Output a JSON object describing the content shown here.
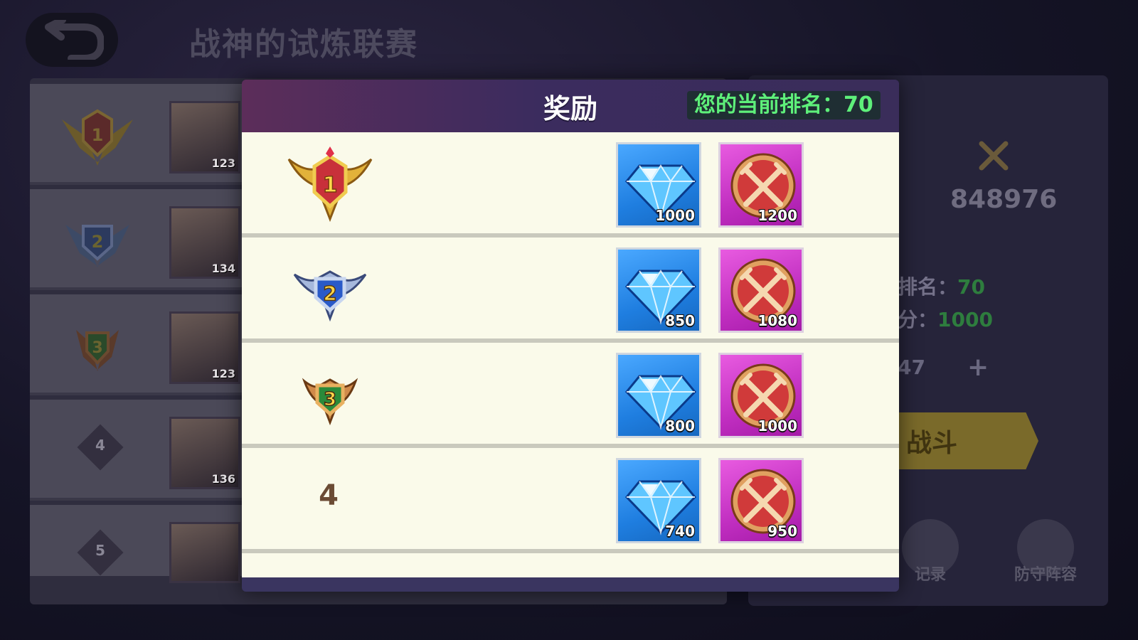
{
  "header": {
    "title": "战神的试炼联赛"
  },
  "left_list": [
    {
      "rank": "1",
      "level": "123",
      "type": "gold"
    },
    {
      "rank": "2",
      "level": "134",
      "type": "silver"
    },
    {
      "rank": "3",
      "level": "123",
      "type": "bronze"
    },
    {
      "rank": "4",
      "level": "136",
      "type": "number"
    },
    {
      "rank": "5",
      "level": "",
      "type": "number"
    }
  ],
  "right_panel": {
    "score": "848976",
    "rank_label": "排名：",
    "rank_value": "70",
    "points_label": "分：",
    "points_value": "1000",
    "tickets": "47",
    "plus": "+",
    "battle_label": "战斗",
    "records_label": "记录",
    "defense_label": "防守阵容"
  },
  "modal": {
    "title": "奖励",
    "current_rank_label": "您的当前排名：70",
    "rewards": [
      {
        "rank": "1",
        "medal": "gold",
        "gems": "1000",
        "coins": "1200"
      },
      {
        "rank": "2",
        "medal": "silver",
        "gems": "850",
        "coins": "1080"
      },
      {
        "rank": "3",
        "medal": "bronze",
        "gems": "800",
        "coins": "1000"
      },
      {
        "rank": "4",
        "medal": "none",
        "gems": "740",
        "coins": "950"
      }
    ]
  },
  "colors": {
    "accent_green": "#5ef07a",
    "gem_blue": "#1f7ee0",
    "coin_magenta": "#c02ec0"
  },
  "icons": {
    "back": "back-arrow-icon",
    "gem": "diamond-gem-icon",
    "coin": "crossed-swords-coin-icon"
  }
}
